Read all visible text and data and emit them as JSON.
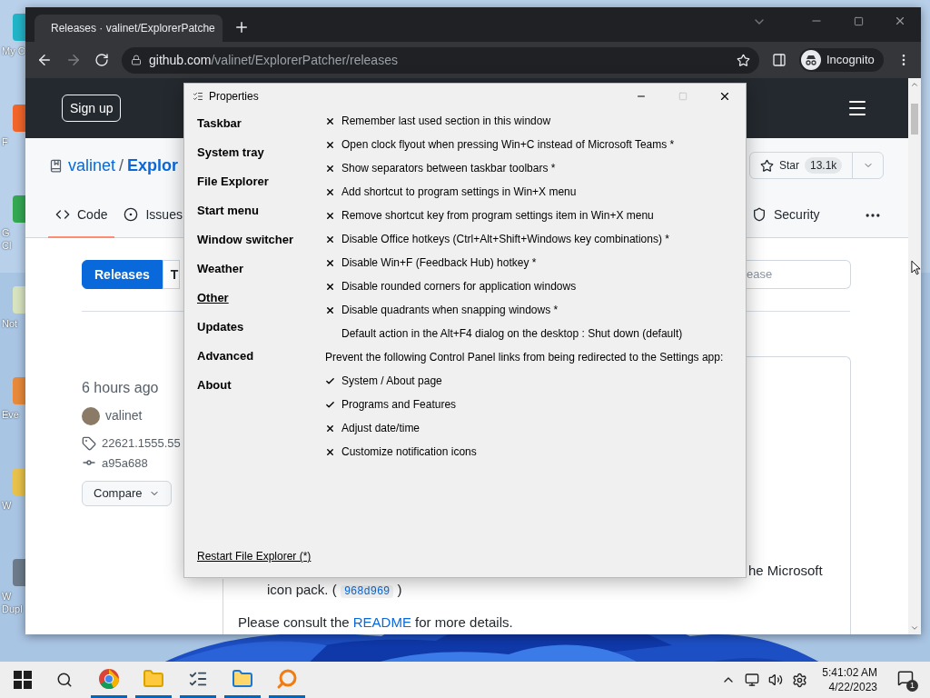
{
  "desktop": {
    "icons": [
      {
        "label_lines": [
          "My C"
        ]
      },
      {
        "label_lines": [
          "F"
        ]
      },
      {
        "label_lines": [
          "G",
          "Cl"
        ]
      },
      {
        "label_lines": [
          "Not"
        ]
      },
      {
        "label_lines": [
          "Eve"
        ]
      },
      {
        "label_lines": [
          "W"
        ]
      },
      {
        "label_lines": [
          "W",
          "Dupl"
        ]
      }
    ]
  },
  "browser": {
    "tab": {
      "title": "Releases · valinet/ExplorerPatche"
    },
    "address": {
      "host": "github.com",
      "path": "/valinet/ExplorerPatcher/releases"
    },
    "profile": "Incognito"
  },
  "github": {
    "sign_up": "Sign up",
    "repo": {
      "owner": "valinet",
      "separator": "/",
      "name": "Explor"
    },
    "star": {
      "label": "Star",
      "count": "13.1k"
    },
    "tabs": [
      {
        "label": "Code",
        "selected": true
      },
      {
        "label": "Issues",
        "selected": false
      },
      {
        "label": "Security",
        "selected": false
      }
    ],
    "release_tabs": [
      {
        "label": "Releases",
        "selected": true
      },
      {
        "label": "T",
        "selected": false
      }
    ],
    "search": {
      "placeholder": "ease"
    },
    "release": {
      "time": "6 hours ago",
      "author": "valinet",
      "tag": "22621.1555.55",
      "commit": "a95a688",
      "compare": "Compare"
    },
    "body": {
      "line_1": "he Microsoft",
      "line_2_before": "icon pack. (",
      "line_2_commit": "968d969",
      "line_2_after": ")",
      "line_3_before": "Please consult the",
      "line_3_link": "README",
      "line_3_after": "for more details."
    }
  },
  "dialog": {
    "title": "Properties",
    "maximize": {
      "disabled": true
    },
    "sections": [
      {
        "label": "Taskbar",
        "selected": false
      },
      {
        "label": "System tray",
        "selected": false
      },
      {
        "label": "File Explorer",
        "selected": false
      },
      {
        "label": "Start menu",
        "selected": false
      },
      {
        "label": "Window switcher",
        "selected": false
      },
      {
        "label": "Weather",
        "selected": false
      },
      {
        "label": "Other",
        "selected": true
      },
      {
        "label": "Updates",
        "selected": false
      },
      {
        "label": "Advanced",
        "selected": false
      },
      {
        "label": "About",
        "selected": false
      }
    ],
    "settings": [
      {
        "kind": "toggle",
        "label": "Remember last used section in this window",
        "checked": false
      },
      {
        "kind": "toggle",
        "label": "Open clock flyout when pressing Win+C instead of Microsoft Teams *",
        "checked": false
      },
      {
        "kind": "toggle",
        "label": "Show separators between taskbar toolbars *",
        "checked": false
      },
      {
        "kind": "toggle",
        "label": "Add shortcut to program settings in Win+X menu",
        "checked": false
      },
      {
        "kind": "toggle",
        "label": "Remove shortcut key from program settings item in Win+X menu",
        "checked": false
      },
      {
        "kind": "toggle",
        "label": "Disable Office hotkeys (Ctrl+Alt+Shift+Windows key combinations) *",
        "checked": false
      },
      {
        "kind": "toggle",
        "label": "Disable Win+F (Feedback Hub) hotkey *",
        "checked": false
      },
      {
        "kind": "toggle",
        "label": "Disable rounded corners for application windows",
        "checked": false
      },
      {
        "kind": "toggle",
        "label": "Disable quadrants when snapping windows *",
        "checked": false
      },
      {
        "kind": "choice",
        "label": "Default action in the Alt+F4 dialog on the desktop : Shut down (default)"
      },
      {
        "kind": "heading",
        "label": "Prevent the following Control Panel links from being redirected to the Settings app:"
      },
      {
        "kind": "toggle",
        "label": "System / About page",
        "checked": true
      },
      {
        "kind": "toggle",
        "label": "Programs and Features",
        "checked": true
      },
      {
        "kind": "toggle",
        "label": "Adjust date/time",
        "checked": false
      },
      {
        "kind": "toggle",
        "label": "Customize notification icons",
        "checked": false
      }
    ],
    "footer_link": "Restart File Explorer (*)"
  },
  "taskbar": {
    "time": "5:41:02 AM",
    "date": "4/22/2023",
    "notifications": "1"
  }
}
